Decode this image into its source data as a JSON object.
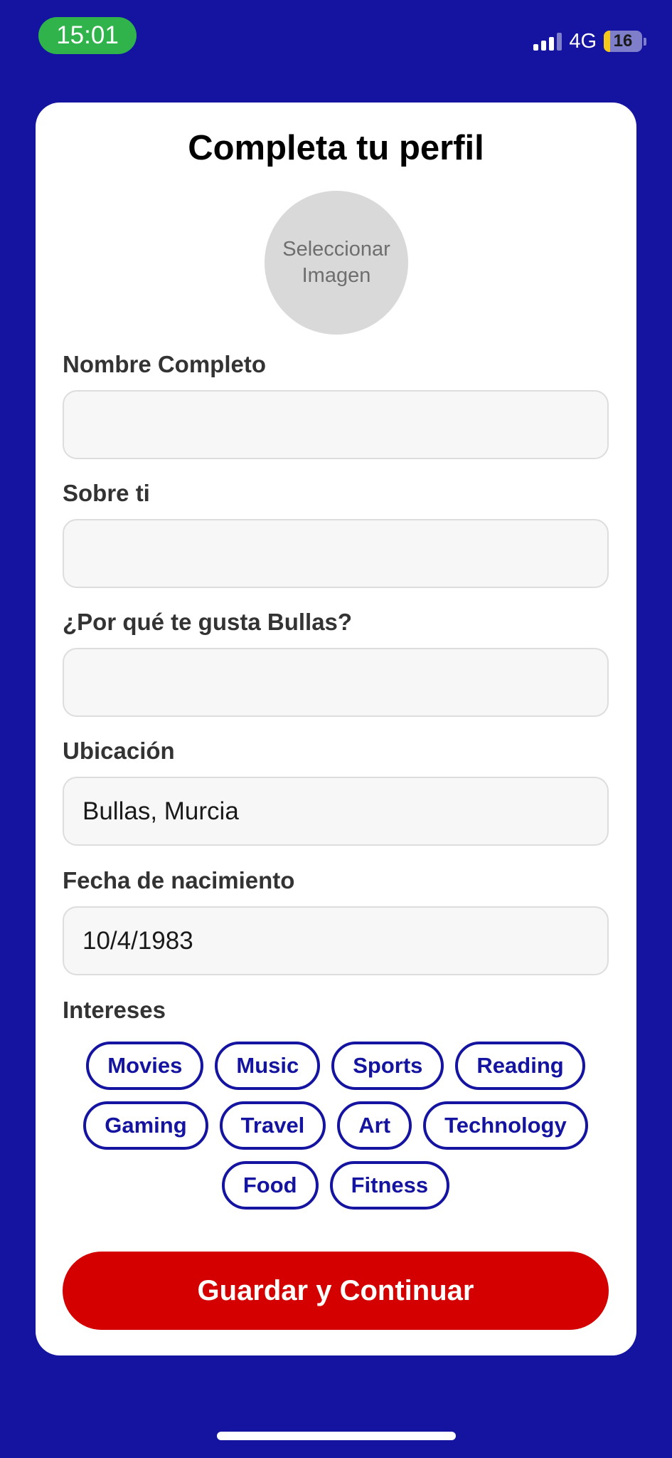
{
  "status_bar": {
    "time": "15:01",
    "network": "4G",
    "battery": "16",
    "battery_level": 0.16
  },
  "form": {
    "title": "Completa tu perfil",
    "avatar_placeholder": "Seleccionar Imagen",
    "fields": [
      {
        "label": "Nombre Completo",
        "value": ""
      },
      {
        "label": "Sobre ti",
        "value": ""
      },
      {
        "label": "¿Por qué te gusta Bullas?",
        "value": ""
      },
      {
        "label": "Ubicación",
        "value": "Bullas, Murcia"
      },
      {
        "label": "Fecha de nacimiento",
        "value": "10/4/1983"
      }
    ],
    "interests_label": "Intereses",
    "interests": [
      "Movies",
      "Music",
      "Sports",
      "Reading",
      "Gaming",
      "Travel",
      "Art",
      "Technology",
      "Food",
      "Fitness"
    ],
    "submit_label": "Guardar y Continuar"
  },
  "colors": {
    "background": "#1414a0",
    "accent": "#1414a0",
    "primary_button": "#d40000",
    "time_pill": "#2fb34a"
  }
}
